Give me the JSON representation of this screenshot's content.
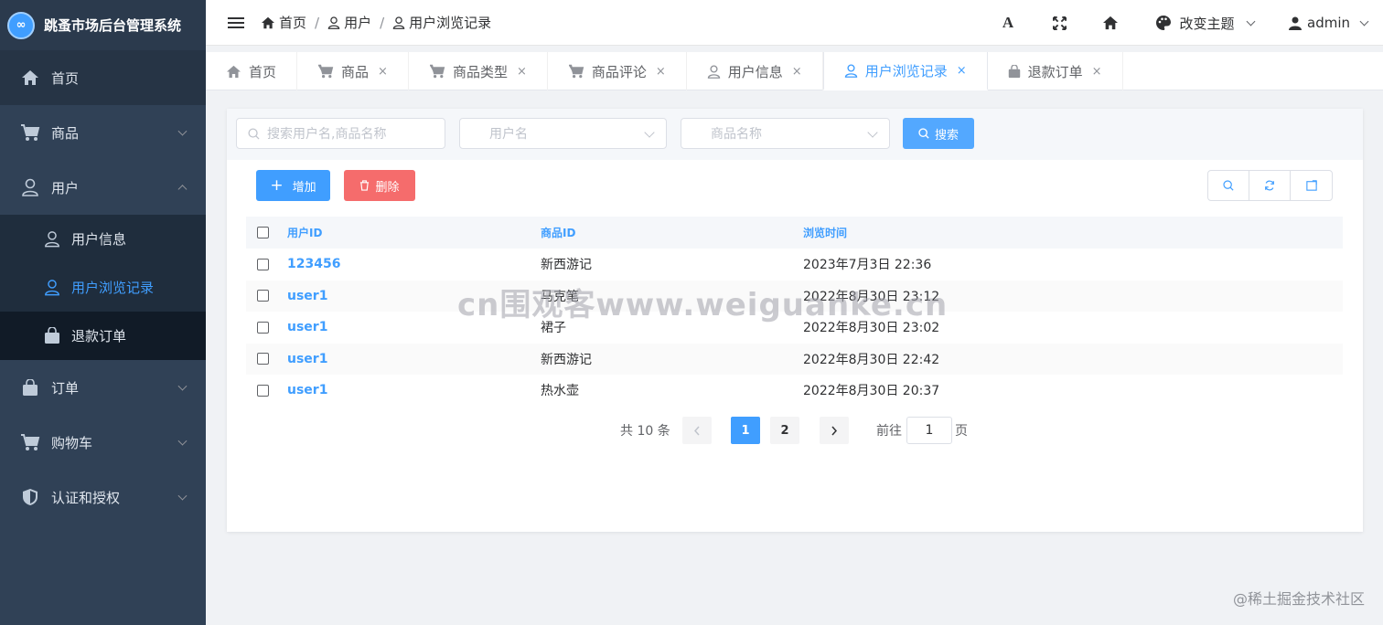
{
  "app": {
    "title": "跳蚤市场后台管理系统",
    "logo_glyph": "∞"
  },
  "sidebar": {
    "items": [
      {
        "label": "首页"
      },
      {
        "label": "商品"
      },
      {
        "label": "用户"
      },
      {
        "label": "订单"
      },
      {
        "label": "购物车"
      },
      {
        "label": "认证和授权"
      }
    ],
    "user_sub": [
      {
        "label": "用户信息"
      },
      {
        "label": "用户浏览记录"
      },
      {
        "label": "退款订单"
      }
    ]
  },
  "header": {
    "breadcrumb": [
      "首页",
      "用户",
      "用户浏览记录"
    ],
    "font_btn": "A",
    "theme_label": "改变主题",
    "user_label": "admin"
  },
  "tabs": [
    {
      "label": "首页"
    },
    {
      "label": "商品"
    },
    {
      "label": "商品类型"
    },
    {
      "label": "商品评论"
    },
    {
      "label": "用户信息"
    },
    {
      "label": "用户浏览记录"
    },
    {
      "label": "退款订单"
    }
  ],
  "tab_close": "×",
  "search": {
    "keyword_placeholder": "搜索用户名,商品名称",
    "username_placeholder": "用户名",
    "goods_placeholder": "商品名称",
    "search_label": "搜索"
  },
  "toolbar": {
    "add_label": "增加",
    "delete_label": "删除"
  },
  "table": {
    "headers": [
      "用户ID",
      "商品ID",
      "浏览时间"
    ],
    "rows": [
      [
        "123456",
        "新西游记",
        "2023年7月3日 22:36"
      ],
      [
        "user1",
        "马克笔",
        "2022年8月30日 23:12"
      ],
      [
        "user1",
        "裙子",
        "2022年8月30日 23:02"
      ],
      [
        "user1",
        "新西游记",
        "2022年8月30日 22:42"
      ],
      [
        "user1",
        "热水壶",
        "2022年8月30日 20:37"
      ]
    ]
  },
  "pagination": {
    "total_label": "共 10 条",
    "pages": [
      "1",
      "2"
    ],
    "goto_label": "前往",
    "goto_value": "1",
    "page_unit": "页"
  },
  "watermark": "cn围观客www.weiguanke.cn",
  "credit": "@稀土掘金技术社区",
  "colors": {
    "sidebar_bg": "#304156",
    "primary": "#409eff",
    "danger": "#f56c6c"
  }
}
